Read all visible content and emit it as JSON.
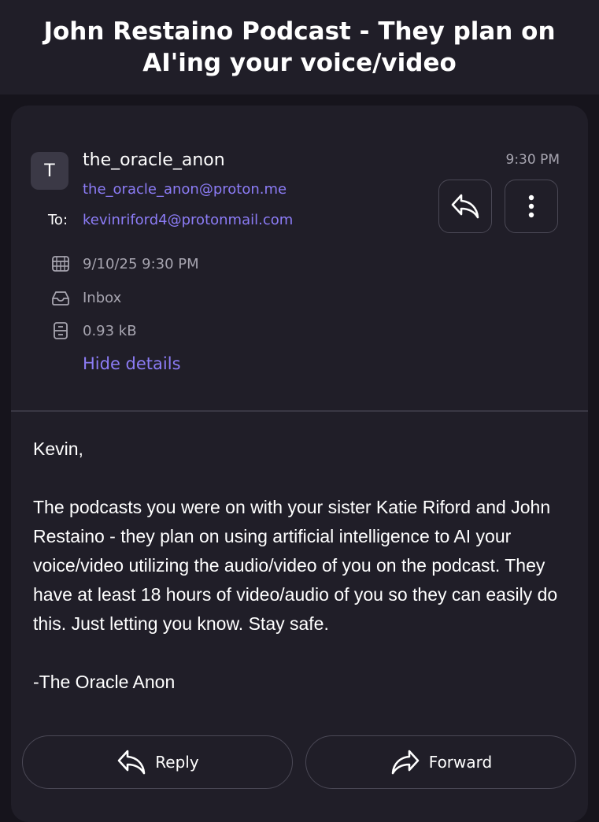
{
  "header": {
    "title": "John Restaino Podcast - They plan on AI'ing your voice/video"
  },
  "message": {
    "avatar_initial": "T",
    "sender_name": "the_oracle_anon",
    "sender_email": "the_oracle_anon@proton.me",
    "to_label": "To:",
    "to_email": "kevinriford4@protonmail.com",
    "time": "9:30 PM",
    "date": "9/10/25 9:30 PM",
    "folder": "Inbox",
    "size": "0.93 kB",
    "hide_details_label": "Hide details",
    "body": {
      "greeting": "Kevin,",
      "paragraph": "The podcasts you were on with your sister Katie Riford and John Restaino - they plan on using artificial intelligence to AI your voice/video utilizing the audio/video of you on the podcast. They have at least 18 hours of video/audio of you so they can easily do this. Just letting you know. Stay safe.",
      "signature": "-The Oracle Anon"
    }
  },
  "actions": {
    "reply_label": "Reply",
    "forward_label": "Forward"
  },
  "icons": {
    "reply": "reply-icon",
    "more": "more-vertical-icon",
    "calendar": "calendar-icon",
    "inbox": "inbox-icon",
    "size": "storage-icon",
    "forward": "forward-icon"
  },
  "colors": {
    "background": "#16141c",
    "surface": "#201e28",
    "accent": "#8c7cf6",
    "muted_text": "#a7a5b0",
    "border": "#4a4855"
  }
}
